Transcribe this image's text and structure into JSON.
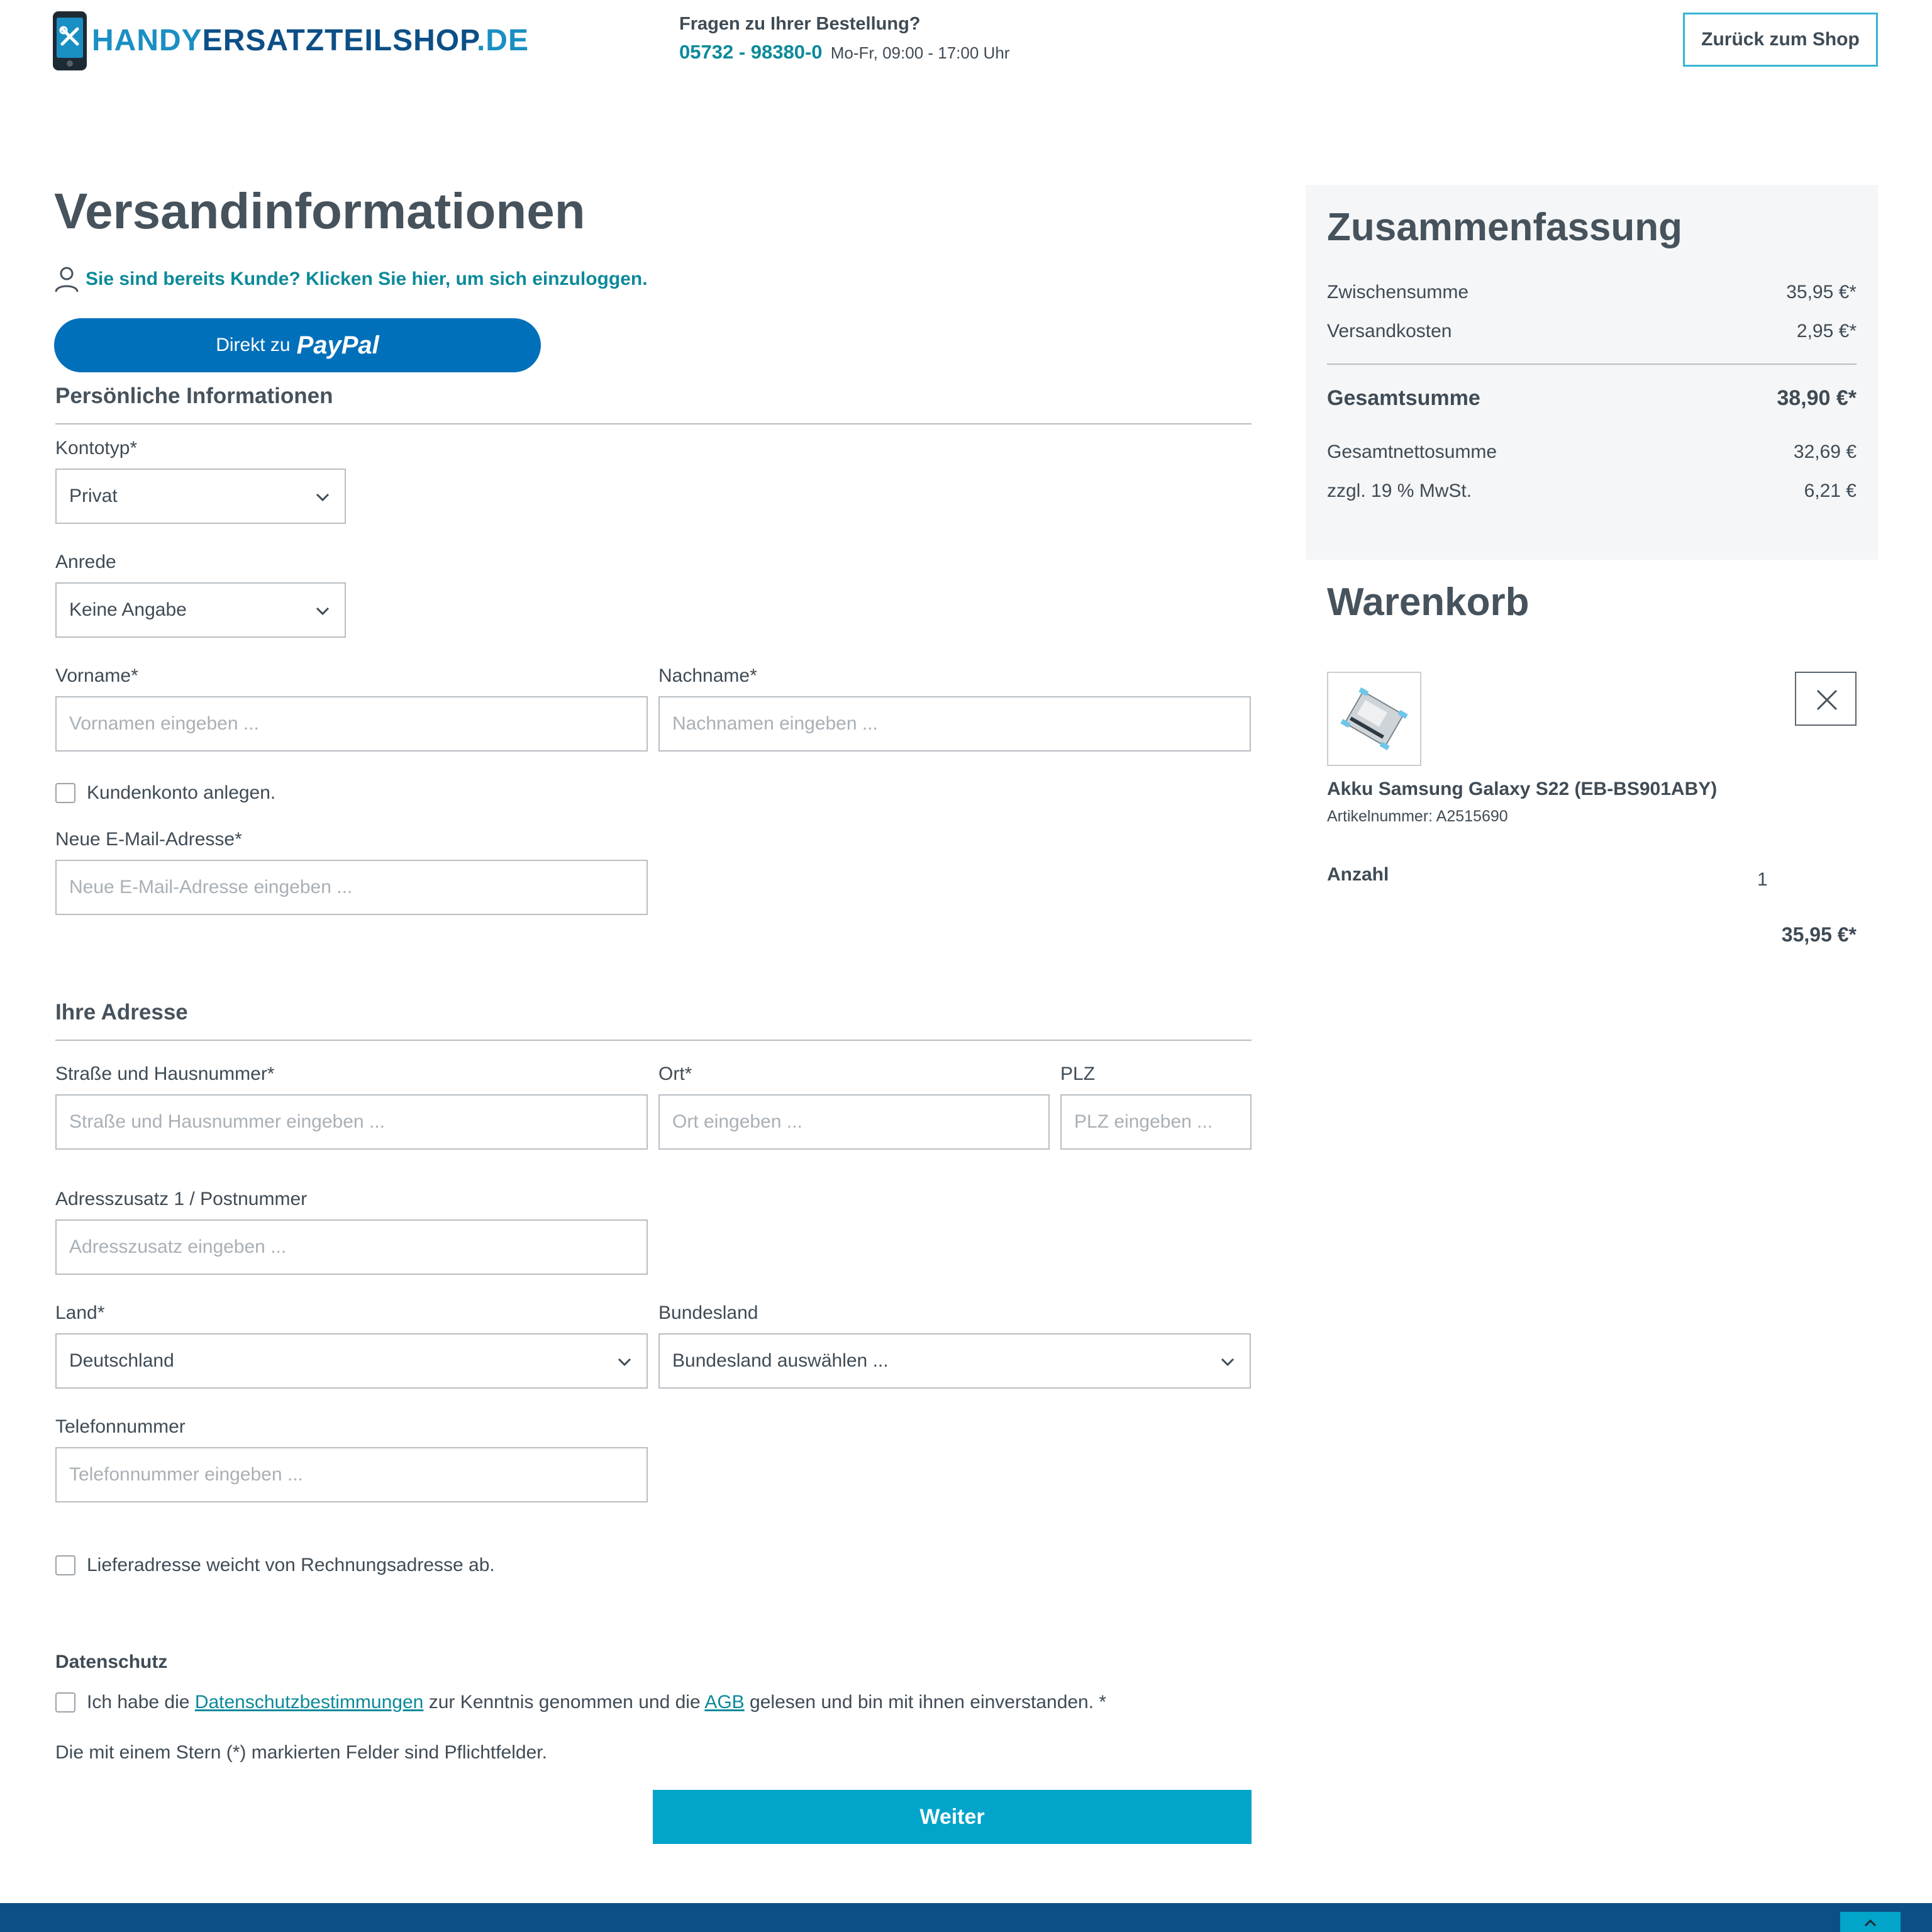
{
  "header": {
    "logo": {
      "part1": "HANDY",
      "part2": "ERSATZTEILSHOP",
      "part3": ".DE"
    },
    "contact_question": "Fragen zu Ihrer Bestellung?",
    "phone": "05732 - 98380-0",
    "hours": "Mo-Fr, 09:00 - 17:00 Uhr",
    "back_button": "Zurück zum Shop"
  },
  "form": {
    "title": "Versandinformationen",
    "login_link": "Sie sind bereits Kunde? Klicken Sie hier, um sich einzuloggen.",
    "paypal": {
      "prefix": "Direkt zu",
      "brand": "PayPal"
    },
    "personal": {
      "section_title": "Persönliche Informationen",
      "account_type_label": "Kontotyp*",
      "account_type_value": "Privat",
      "salutation_label": "Anrede",
      "salutation_value": "Keine Angabe",
      "firstname_label": "Vorname*",
      "firstname_placeholder": "Vornamen eingeben ...",
      "lastname_label": "Nachname*",
      "lastname_placeholder": "Nachnamen eingeben ...",
      "create_account_label": "Kundenkonto anlegen.",
      "email_label": "Neue E-Mail-Adresse*",
      "email_placeholder": "Neue E-Mail-Adresse eingeben ..."
    },
    "address": {
      "section_title": "Ihre Adresse",
      "street_label": "Straße und Hausnummer*",
      "street_placeholder": "Straße und Hausnummer eingeben ...",
      "city_label": "Ort*",
      "city_placeholder": "Ort eingeben ...",
      "zip_label": "PLZ",
      "zip_placeholder": "PLZ eingeben ...",
      "addition_label": "Adresszusatz 1 / Postnummer",
      "addition_placeholder": "Adresszusatz eingeben ...",
      "country_label": "Land*",
      "country_value": "Deutschland",
      "state_label": "Bundesland",
      "state_value": "Bundesland auswählen ...",
      "phone_label": "Telefonnummer",
      "phone_placeholder": "Telefonnummer eingeben ...",
      "different_shipping_label": "Lieferadresse weicht von Rechnungsadresse ab."
    },
    "privacy": {
      "title": "Datenschutz",
      "text_before": "Ich habe die",
      "link_privacy": "Datenschutzbestimmungen",
      "text_middle": "zur Kenntnis genommen und die",
      "link_agb": "AGB",
      "text_after": "gelesen und bin mit ihnen einverstanden. *"
    },
    "required_note": "Die mit einem Stern (*) markierten Felder sind Pflichtfelder.",
    "submit": "Weiter"
  },
  "summary": {
    "title": "Zusammenfassung",
    "subtotal_label": "Zwischensumme",
    "subtotal_value": "35,95 €*",
    "shipping_label": "Versandkosten",
    "shipping_value": "2,95 €*",
    "total_label": "Gesamtsumme",
    "total_value": "38,90 €*",
    "net_label": "Gesamtnettosumme",
    "net_value": "32,69 €",
    "vat_label": "zzgl. 19 % MwSt.",
    "vat_value": "6,21 €"
  },
  "cart": {
    "title": "Warenkorb",
    "item": {
      "name": "Akku Samsung Galaxy S22 (EB-BS901ABY)",
      "sku": "Artikelnummer: A2515690",
      "quantity_label": "Anzahl",
      "quantity": "1",
      "price": "35,95 €*"
    }
  },
  "colors": {
    "accent": "#0c8a9a",
    "primary_button": "#02a4ca",
    "paypal": "#0070ba",
    "footer": "#0c4f86"
  }
}
